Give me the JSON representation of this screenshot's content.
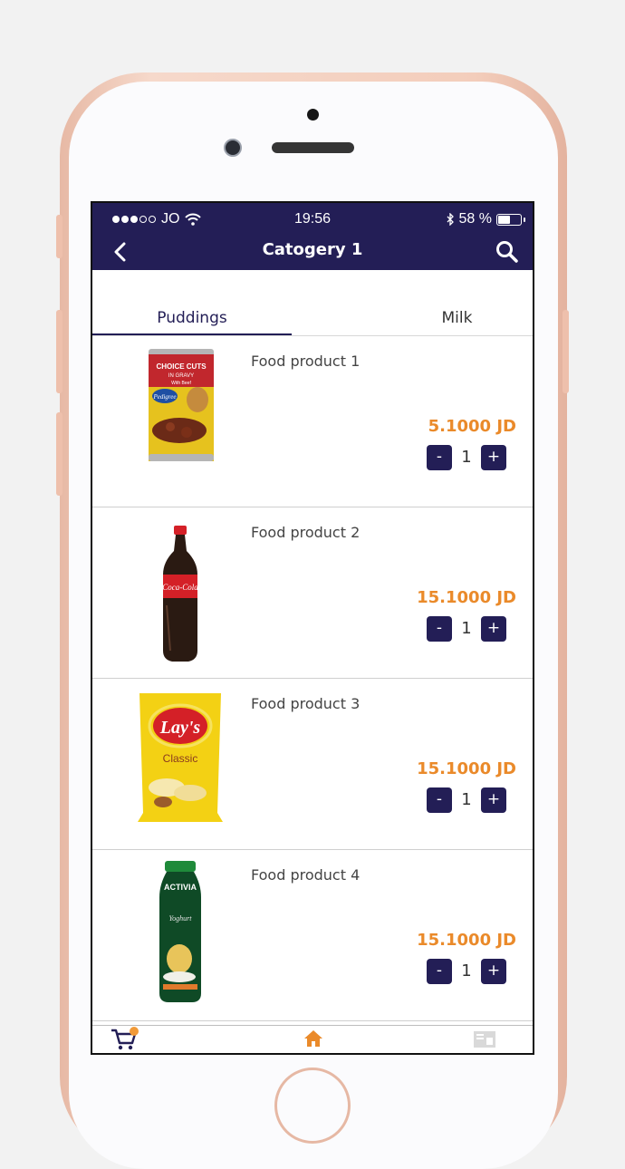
{
  "status_bar": {
    "carrier": "JO",
    "time": "19:56",
    "battery": "58 %",
    "battery_level": 0.58
  },
  "nav": {
    "title": "Catogery 1",
    "back_icon": "chevron-left-icon",
    "search_icon": "search-icon"
  },
  "tabs": [
    {
      "label": "Puddings",
      "active": true
    },
    {
      "label": "Milk",
      "active": false
    }
  ],
  "products": [
    {
      "name": "Food product 1",
      "price": "5.1000 JD",
      "quantity": "1",
      "minus": "-",
      "plus": "+",
      "image": "dog-food-can"
    },
    {
      "name": "Food product 2",
      "price": "15.1000 JD",
      "quantity": "1",
      "minus": "-",
      "plus": "+",
      "image": "soda-bottle"
    },
    {
      "name": "Food product 3",
      "price": "15.1000 JD",
      "quantity": "1",
      "minus": "-",
      "plus": "+",
      "image": "chips-bag"
    },
    {
      "name": "Food product 4",
      "price": "15.1000 JD",
      "quantity": "1",
      "minus": "-",
      "plus": "+",
      "image": "yogurt-bottle"
    }
  ],
  "product_images": {
    "can_line1": "CHOICE CUTS",
    "can_line2": "IN GRAVY",
    "can_line3": "With Beef",
    "can_brand": "Pedigree",
    "soda_brand": "Coca-Cola",
    "chips_brand": "Lay's",
    "chips_flavor": "Classic",
    "yogurt_brand": "ACTIVIA",
    "yogurt_type": "Yoghurt"
  },
  "bottom_tabs": [
    {
      "icon": "cart-icon",
      "active": false
    },
    {
      "icon": "home-icon",
      "active": true
    },
    {
      "icon": "invoice-icon",
      "active": false
    }
  ],
  "colors": {
    "primary": "#231e56",
    "accent": "#ea8a2a",
    "background": "#ffffff"
  }
}
